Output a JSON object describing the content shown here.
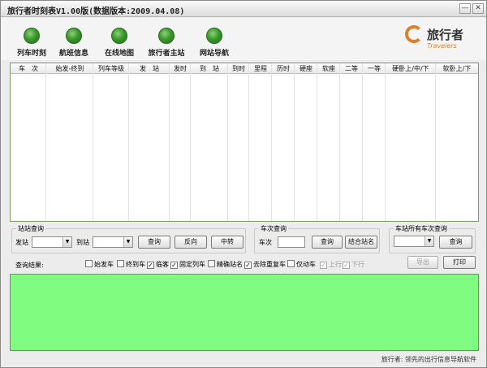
{
  "window": {
    "title": "旅行者时刻表V1.00版(数据版本:2009.04.08)",
    "minimize_glyph": "—",
    "close_glyph": "✕"
  },
  "toolbar": {
    "items": [
      {
        "label": "列车时刻",
        "icon": "green-orb-icon"
      },
      {
        "label": "航班信息",
        "icon": "green-orb-icon"
      },
      {
        "label": "在线地图",
        "icon": "green-orb-icon"
      },
      {
        "label": "旅行者主站",
        "icon": "green-orb-icon"
      },
      {
        "label": "网站导航",
        "icon": "green-orb-icon"
      }
    ],
    "logo_cn": "旅行者",
    "logo_en": "Travelers"
  },
  "table": {
    "columns": [
      "车　次",
      "始发-终到",
      "列车等级",
      "发　站",
      "发时",
      "到　站",
      "到时",
      "里程",
      "历时",
      "硬座",
      "软座",
      "二等",
      "一等",
      "硬卧上/中/下",
      "软卧上/下"
    ],
    "rows": []
  },
  "station_query": {
    "legend": "站站查询",
    "from_label": "发站",
    "to_label": "到站",
    "from_value": "",
    "to_value": "",
    "query_button": "查询",
    "reverse_button": "反向",
    "transfer_button": "中转"
  },
  "train_query": {
    "legend": "车次查询",
    "train_label": "车次",
    "train_value": "",
    "query_button": "查询",
    "combine_button": "结合站名"
  },
  "station_all_query": {
    "legend": "车站所有车次查询",
    "station_value": "",
    "query_button": "查询"
  },
  "actions": {
    "export_button": "导出",
    "print_button": "打印"
  },
  "results": {
    "label": "查询结果:",
    "filters": [
      {
        "label": "始发车",
        "checked": false,
        "enabled": true
      },
      {
        "label": "终到车",
        "checked": false,
        "enabled": true
      },
      {
        "label": "临客",
        "checked": true,
        "enabled": true
      },
      {
        "label": "固定列车",
        "checked": true,
        "enabled": true
      },
      {
        "label": "精确站名",
        "checked": false,
        "enabled": true
      },
      {
        "label": "去除重复车",
        "checked": true,
        "enabled": true
      },
      {
        "label": "仅动车",
        "checked": false,
        "enabled": true
      },
      {
        "label": "上行",
        "checked": true,
        "enabled": false
      },
      {
        "label": "下行",
        "checked": true,
        "enabled": false
      }
    ],
    "area_color": "#80fd80"
  },
  "footer": {
    "text": "旅行者: 领先的出行信息导航软件"
  }
}
